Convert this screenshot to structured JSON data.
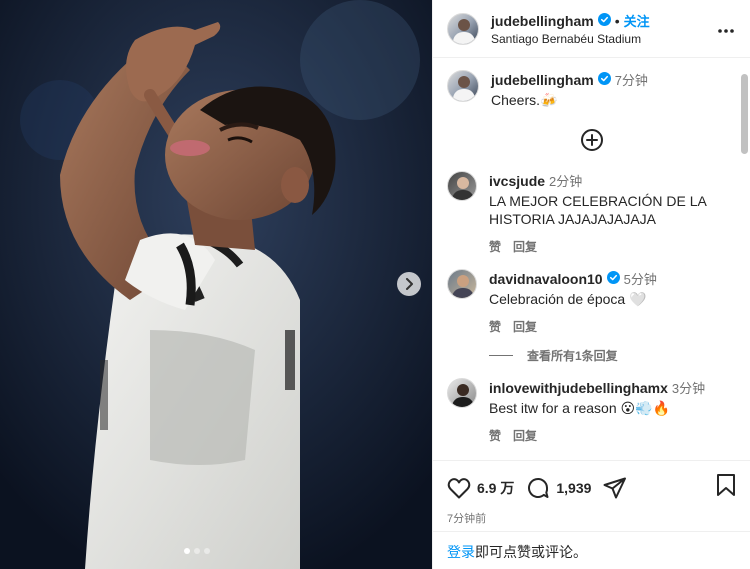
{
  "header": {
    "username": "judebellingham",
    "follow_label": "关注",
    "separator": "•",
    "location": "Santiago Bernabéu Stadium"
  },
  "caption": {
    "username": "judebellingham",
    "time": "7分钟",
    "text": "Cheers.🍻"
  },
  "comments": [
    {
      "username": "ivcsjude",
      "time": "2分钟",
      "text": "LA MEJOR CELEBRACIÓN DE LA HISTORIA JAJAJAJAJAJA",
      "like_label": "赞",
      "reply_label": "回复"
    },
    {
      "username": "davidnavaloon10",
      "time": "5分钟",
      "text": "Celebración de época 🤍",
      "like_label": "赞",
      "reply_label": "回复",
      "view_replies": "查看所有1条回复"
    },
    {
      "username": "inlovewithjudebellinghamx",
      "time": "3分钟",
      "text": "Best itw for a reason 😮💨🔥",
      "like_label": "赞",
      "reply_label": "回复"
    }
  ],
  "stats": {
    "likes": "6.9 万",
    "comments": "1,939",
    "posted": "7分钟前"
  },
  "login": {
    "link": "登录",
    "rest": "即可点赞或评论。"
  },
  "colors": {
    "accent": "#0095f6",
    "verified": "#0095f6",
    "muted": "#737373"
  },
  "icons": {
    "more": "more-horizontal-icon",
    "add_comment": "plus-circle-icon",
    "like": "heart-icon",
    "comment": "comment-bubble-icon",
    "share": "paper-plane-icon",
    "save": "bookmark-icon",
    "next": "chevron-right-icon"
  }
}
